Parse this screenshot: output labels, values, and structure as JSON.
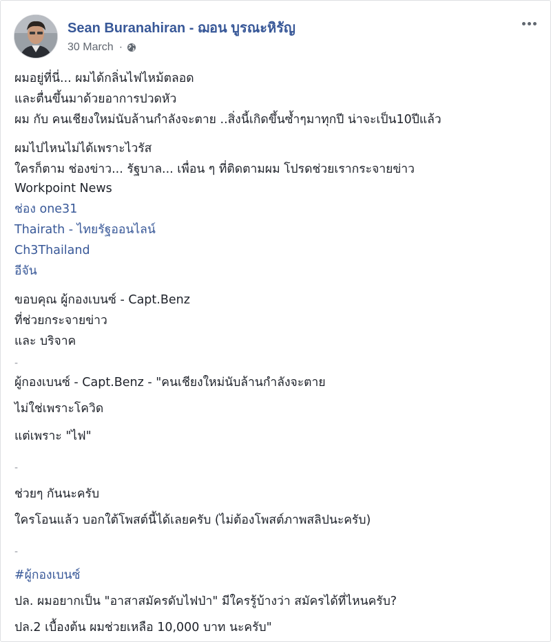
{
  "post": {
    "author": "Sean Buranahiran - ฌอน บูรณะหิรัญ",
    "date": "30 March",
    "separator": "·",
    "privacy_icon": "globe-icon",
    "menu_icon": "more-options-icon"
  },
  "content": {
    "l01": "ผมอยู่ที่นี่... ผมได้กลิ่นไฟไหม้ตลอด",
    "l02": "และตื่นขึ้นมาด้วยอาการปวดหัว",
    "l03": "ผม กับ คนเชียงใหม่นับล้านกำลังจะตาย ..สิ่งนี้เกิดขึ้นซ้ำๆมาทุกปี น่าจะเป็น10ปีแล้ว",
    "l04": "ผมไปไหนไม่ได้เพราะไวรัส",
    "l05": "ใครก็ตาม ช่องข่าว... รัฐบาล... เพื่อน ๆ ที่ติดตามผม โปรดช่วยเรากระจายข่าว",
    "l06": "Workpoint News",
    "l07": "ช่อง one31",
    "l08": "Thairath - ไทยรัฐออนไลน์",
    "l09": "Ch3Thailand",
    "l10": "อีจัน",
    "l11": "ขอบคุณ ผู้กองเบนซ์ - Capt.Benz",
    "l12": "ที่ช่วยกระจายข่าว",
    "l13": "และ บริจาค",
    "l14": "-",
    "l15": "ผู้กองเบนซ์ - Capt.Benz - \"คนเชียงใหม่นับล้านกำลังจะตาย",
    "l16": "ไม่ใช่เพราะโควิด",
    "l17": "แต่เพราะ \"ไฟ\"",
    "l18": "-",
    "l19": "ช่วยๆ กันนะครับ",
    "l20": "ใครโอนแล้ว บอกใต้โพสต์นี้ได้เลยครับ (ไม่ต้องโพสต์ภาพสลิปนะครับ)",
    "l21": "-",
    "l22": "#ผู้กองเบนซ์",
    "l23": "ปล. ผมอยากเป็น \"อาสาสมัครดับไฟป่า\" มีใครรู้บ้างว่า สมัครได้ที่ไหนครับ?",
    "l24": "ปล.2 เบื้องต้น ผมช่วยเหลือ 10,000 บาท นะครับ\""
  }
}
